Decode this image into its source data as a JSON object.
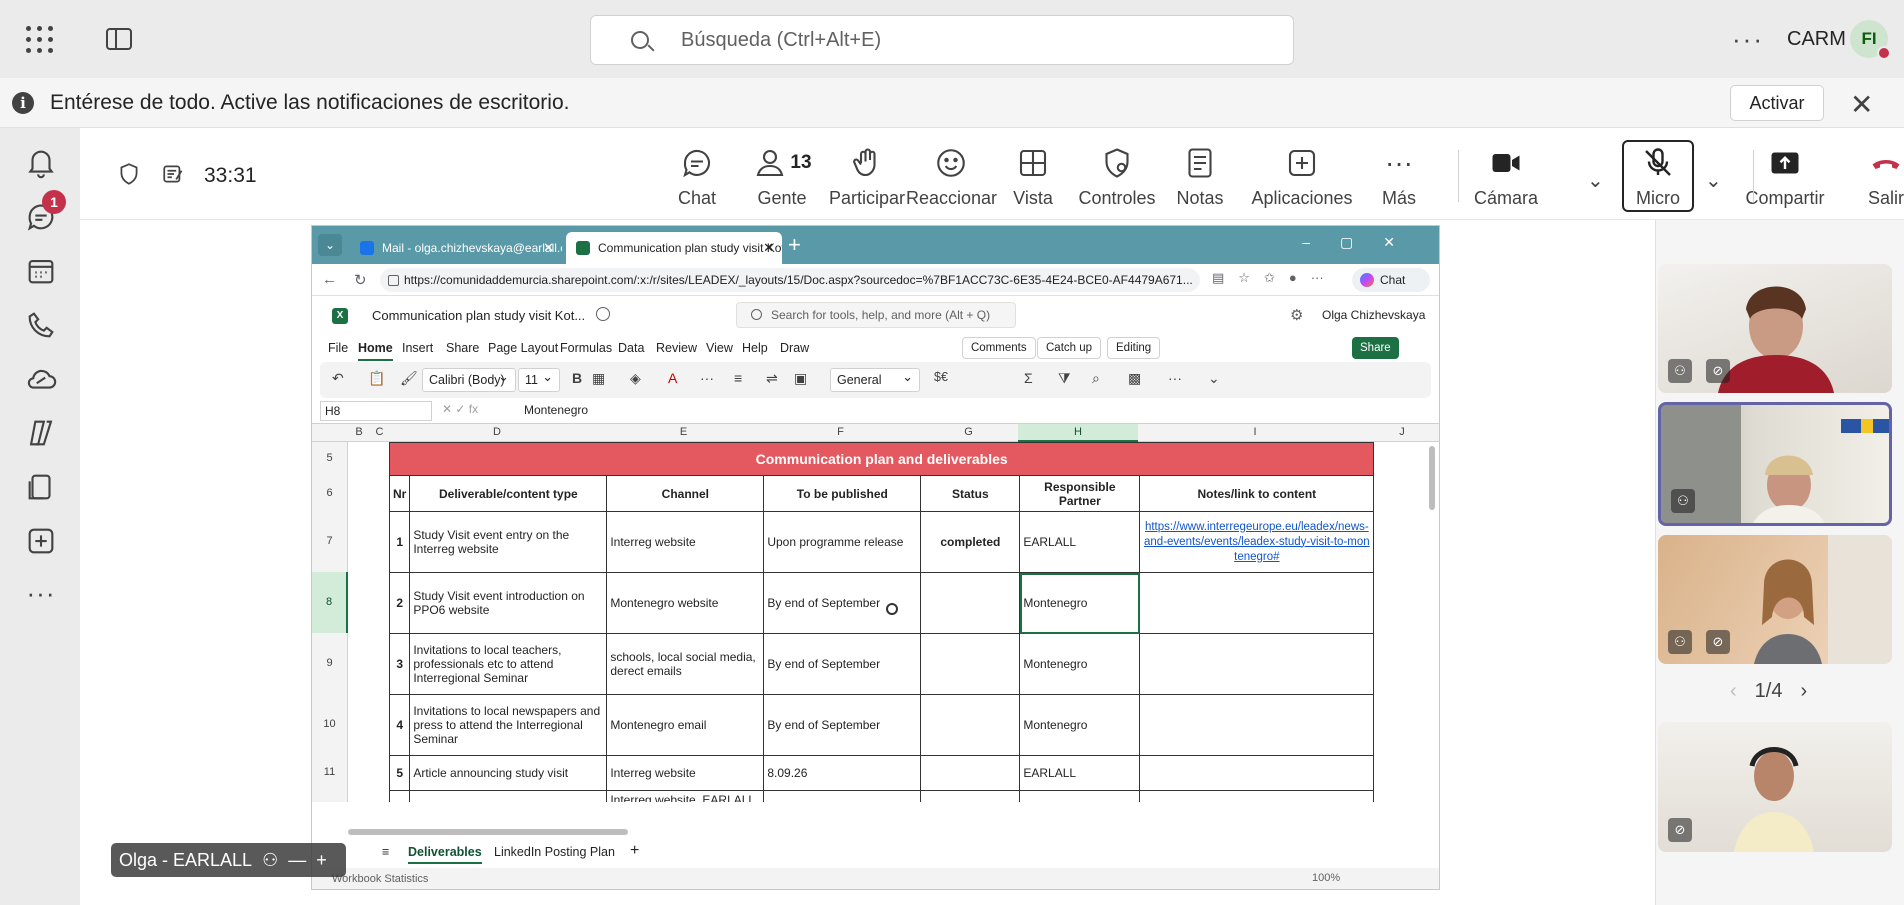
{
  "topbar": {
    "search_placeholder": "Búsqueda (Ctrl+Alt+E)",
    "more": "···",
    "org": "CARM",
    "avatar_initials": "FI"
  },
  "notification": {
    "text": "Entérese de todo. Active las notificaciones de escritorio.",
    "action": "Activar",
    "close": "✕"
  },
  "rail": {
    "chat_badge": "1"
  },
  "meeting": {
    "timer": "33:31",
    "controls": {
      "chat": "Chat",
      "people": "Gente",
      "people_count": "13",
      "raise": "Participar",
      "react": "Reaccionar",
      "view": "Vista",
      "controls": "Controles",
      "notes": "Notas",
      "apps": "Aplicaciones",
      "more": "Más",
      "camera": "Cámara",
      "mic": "Micro",
      "share": "Compartir",
      "leave": "Salir"
    }
  },
  "browser": {
    "tab1": "Mail - olga.chizhevskaya@earlall.eu",
    "tab2": "Communication plan study visit Kotor",
    "url": "https://comunidaddemurcia.sharepoint.com/:x:/r/sites/LEADEX/_layouts/15/Doc.aspx?sourcedoc=%7BF1ACC73C-6E35-4E24-BCE0-AF4479A671...",
    "chat": "Chat"
  },
  "excel": {
    "doc_title": "Communication plan study visit Kot...",
    "search": "Search for tools, help, and more (Alt + Q)",
    "user": "Olga Chizhevskaya",
    "menu": [
      "File",
      "Home",
      "Insert",
      "Share",
      "Page Layout",
      "Formulas",
      "Data",
      "Review",
      "View",
      "Help",
      "Draw"
    ],
    "comments": "Comments",
    "catchup": "Catch up",
    "editing": "Editing",
    "share": "Share",
    "font": "Calibri (Body)",
    "size": "11",
    "format": "General",
    "currency": "$€",
    "namebox": "H8",
    "formula": "Montenegro",
    "columns": [
      "B",
      "C",
      "D",
      "E",
      "F",
      "G",
      "H",
      "I",
      "J"
    ],
    "rows": [
      "5",
      "6",
      "7",
      "8",
      "9",
      "10",
      "11"
    ],
    "banner": "Communication plan and deliverables",
    "headers": [
      "Nr",
      "Deliverable/content type",
      "Channel",
      "To be published",
      "Status",
      "Responsible Partner",
      "Notes/link to content"
    ],
    "data": [
      {
        "nr": "1",
        "type": "Study Visit event entry on the Interreg website",
        "channel": "Interreg website",
        "when": "Upon programme release",
        "status": "completed",
        "partner": "EARLALL",
        "notes": "https://www.interregeurope.eu/leadex/news-and-events/events/leadex-study-visit-to-montenegro#"
      },
      {
        "nr": "2",
        "type": "Study Visit event introduction on PPO6 website",
        "channel": "Montenegro website",
        "when": "By end of September",
        "status": "",
        "partner": "Montenegro",
        "notes": ""
      },
      {
        "nr": "3",
        "type": "Invitations to local teachers, professionals etc to attend Interregional Seminar",
        "channel": "schools, local social media, derect emails",
        "when": "By end of September",
        "status": "",
        "partner": "Montenegro",
        "notes": ""
      },
      {
        "nr": "4",
        "type": "Invitations to local newspapers and press to attend the Interregional Seminar",
        "channel": "Montenegro email",
        "when": "By end of September",
        "status": "",
        "partner": "Montenegro",
        "notes": ""
      },
      {
        "nr": "5",
        "type": "Article announcing study visit",
        "channel": "Interreg website",
        "when": "8.09.26",
        "status": "",
        "partner": "EARLALL",
        "notes": ""
      },
      {
        "nr": "",
        "type": "",
        "channel": "Interreg website, EARLALL",
        "when": "",
        "status": "",
        "partner": "",
        "notes": ""
      }
    ],
    "sheets": [
      "Deliverables",
      "LinkedIn Posting Plan"
    ],
    "status": "Workbook Statistics",
    "zoom": "100%"
  },
  "presenter": "Olga - EARLALL",
  "pager": "1/4",
  "colors": {
    "banner": "#e4585f",
    "excel_green": "#1d7044",
    "leave_red": "#c4314b",
    "browser_tabs": "#5a9aa8"
  }
}
